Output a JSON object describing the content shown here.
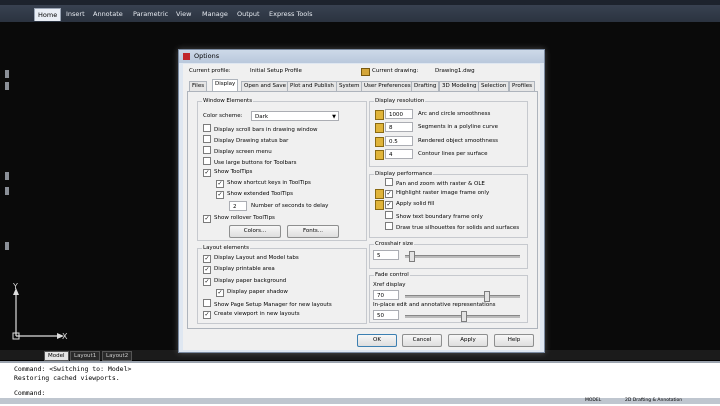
{
  "ribbon": {
    "tabs": [
      {
        "label": "Home",
        "active": true
      },
      {
        "label": "Insert"
      },
      {
        "label": "Annotate"
      },
      {
        "label": "Parametric"
      },
      {
        "label": "View"
      },
      {
        "label": "Manage"
      },
      {
        "label": "Output"
      },
      {
        "label": "Express Tools"
      }
    ]
  },
  "layout_tabs": [
    "Model",
    "Layout1",
    "Layout2"
  ],
  "command_lines": [
    "Command:  <Switching to: Model>",
    "Restoring cached viewports.",
    "Command:"
  ],
  "ucs": {
    "y": "Y",
    "x": "X"
  },
  "status": {
    "right": "MODEL",
    "ws": "2D Drafting & Annotation"
  },
  "dialog": {
    "title": "Options",
    "current_profile_label": "Current profile:",
    "current_profile_value": "Initial Setup Profile",
    "current_drawing_label": "Current drawing:",
    "current_drawing_value": "Drawing1.dwg",
    "tabs": [
      "Files",
      "Display",
      "Open and Save",
      "Plot and Publish",
      "System",
      "User Preferences",
      "Drafting",
      "3D Modeling",
      "Selection",
      "Profiles"
    ],
    "window_elements": {
      "title": "Window Elements",
      "color_scheme_label": "Color scheme:",
      "color_scheme_value": "Dark",
      "options": [
        {
          "label": "Display scroll bars in drawing window",
          "checked": false
        },
        {
          "label": "Display Drawing status bar",
          "checked": false
        },
        {
          "label": "Display screen menu",
          "checked": false
        },
        {
          "label": "Use large buttons for Toolbars",
          "checked": false
        },
        {
          "label": "Show ToolTips",
          "checked": true
        },
        {
          "label": "Show shortcut keys in ToolTips",
          "checked": true
        },
        {
          "label": "Show extended ToolTips",
          "checked": true
        },
        {
          "label": "Show rollover ToolTips",
          "checked": true
        }
      ],
      "seconds_value": "2",
      "seconds_label": "Number of seconds to delay",
      "colors_button": "Colors...",
      "fonts_button": "Fonts..."
    },
    "layout_elements": {
      "title": "Layout elements",
      "options": [
        {
          "label": "Display Layout and Model tabs",
          "checked": true
        },
        {
          "label": "Display printable area",
          "checked": true
        },
        {
          "label": "Display paper background",
          "checked": true
        },
        {
          "label": "Display paper shadow",
          "checked": true
        },
        {
          "label": "Show Page Setup Manager for new layouts",
          "checked": false
        },
        {
          "label": "Create viewport in new layouts",
          "checked": true
        }
      ]
    },
    "display_resolution": {
      "title": "Display resolution",
      "rows": [
        {
          "value": "1000",
          "label": "Arc and circle smoothness"
        },
        {
          "value": "8",
          "label": "Segments in a polyline curve"
        },
        {
          "value": "0.5",
          "label": "Rendered object smoothness"
        },
        {
          "value": "4",
          "label": "Contour lines per surface"
        }
      ]
    },
    "display_performance": {
      "title": "Display performance",
      "options": [
        {
          "label": "Pan and zoom with raster & OLE",
          "checked": false
        },
        {
          "label": "Highlight raster image frame only",
          "checked": true
        },
        {
          "label": "Apply solid fill",
          "checked": true
        },
        {
          "label": "Show text boundary frame only",
          "checked": false
        },
        {
          "label": "Draw true silhouettes for solids and surfaces",
          "checked": false
        }
      ]
    },
    "crosshair": {
      "title": "Crosshair size",
      "value": "5",
      "level": 0.05
    },
    "fade": {
      "title": "Fade control",
      "xref_label": "Xref display",
      "xref_value": "70",
      "xref_level": 0.7,
      "inplace_label": "In-place edit and annotative representations",
      "inplace_value": "50",
      "inplace_level": 0.5
    },
    "buttons": {
      "ok": "OK",
      "cancel": "Cancel",
      "apply": "Apply",
      "help": "Help"
    }
  }
}
